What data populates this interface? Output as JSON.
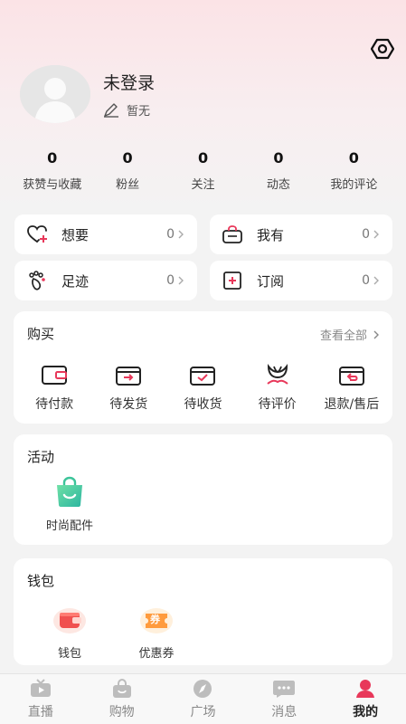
{
  "profile": {
    "username": "未登录",
    "bio": "暂无"
  },
  "stats": [
    {
      "value": "0",
      "label": "获赞与收藏"
    },
    {
      "value": "0",
      "label": "粉丝"
    },
    {
      "value": "0",
      "label": "关注"
    },
    {
      "value": "0",
      "label": "动态"
    },
    {
      "value": "0",
      "label": "我的评论"
    }
  ],
  "quick_cards": [
    {
      "label": "想要",
      "count": "0",
      "icon": "heart-plus-icon"
    },
    {
      "label": "我有",
      "count": "0",
      "icon": "basket-icon"
    },
    {
      "label": "足迹",
      "count": "0",
      "icon": "footprint-icon"
    },
    {
      "label": "订阅",
      "count": "0",
      "icon": "subscribe-icon"
    }
  ],
  "purchase": {
    "title": "购买",
    "view_all": "查看全部",
    "items": [
      {
        "label": "待付款",
        "icon": "wallet-icon"
      },
      {
        "label": "待发货",
        "icon": "ship-box-icon"
      },
      {
        "label": "待收货",
        "icon": "receive-box-icon"
      },
      {
        "label": "待评价",
        "icon": "flower-rate-icon"
      },
      {
        "label": "退款/售后",
        "icon": "refund-box-icon"
      }
    ]
  },
  "activity": {
    "title": "活动",
    "items": [
      {
        "label": "时尚配件",
        "icon": "shopping-bag-icon"
      }
    ]
  },
  "wallet": {
    "title": "钱包",
    "items": [
      {
        "label": "钱包",
        "icon": "wallet-red-icon"
      },
      {
        "label": "优惠券",
        "icon": "coupon-icon",
        "badge": "券"
      }
    ]
  },
  "tabs": [
    {
      "label": "直播",
      "icon": "tv-icon",
      "active": false
    },
    {
      "label": "购物",
      "icon": "shopping-icon",
      "active": false
    },
    {
      "label": "广场",
      "icon": "compass-icon",
      "active": false
    },
    {
      "label": "消息",
      "icon": "message-icon",
      "active": false
    },
    {
      "label": "我的",
      "icon": "profile-icon",
      "active": true
    }
  ],
  "colors": {
    "accent": "#e8385a",
    "header_pink": "#fbe3e6",
    "background": "#f3f3f3"
  }
}
